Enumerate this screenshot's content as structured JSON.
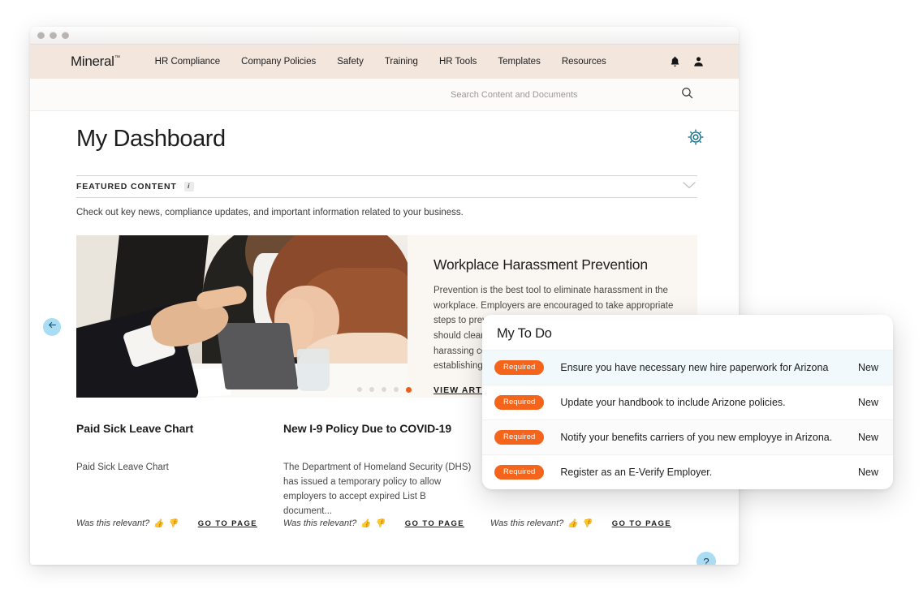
{
  "window": {
    "traffic_lights": [
      "close",
      "minimize",
      "maximize"
    ]
  },
  "nav": {
    "logo": "Mineral",
    "logo_tm": "™",
    "links": [
      {
        "label": "HR Compliance"
      },
      {
        "label": "Company Policies"
      },
      {
        "label": "Safety"
      },
      {
        "label": "Training"
      },
      {
        "label": "HR Tools"
      },
      {
        "label": "Templates"
      },
      {
        "label": "Resources"
      }
    ],
    "icons": [
      {
        "name": "bell-icon"
      },
      {
        "name": "user-avatar-icon"
      }
    ]
  },
  "search": {
    "placeholder": "Search Content and Documents",
    "value": "",
    "icon": "search-icon"
  },
  "dashboard": {
    "title": "My Dashboard",
    "settings_icon": "gear-icon",
    "settings_color": "#0f6d8c"
  },
  "featured": {
    "label": "FEATURED CONTENT",
    "info_icon": "info-icon",
    "info_glyph": "i",
    "collapse_icon": "chevron-down-icon",
    "subtitle": "Check out key news, compliance updates, and important information related to your business."
  },
  "hero": {
    "image_alt": "workplace-harassment-photo",
    "title": "Workplace Harassment Prevention",
    "body": "Prevention is the best tool to eliminate harassment in the workplace. Employers are encouraged to take appropriate steps to prevent and correct unlawful harassment. They should clearly communicate to employees that unwelcome harassing conduct will not be tolerated. They can do this by establishing an effec",
    "link": "VIEW ARTICLE"
  },
  "cards": [
    {
      "title": "Paid Sick Leave Chart",
      "body": "Paid Sick Leave Chart",
      "relevant_label": "Was this relevant?",
      "thumb_up": "👍",
      "thumb_down": "👎",
      "goto": "GO TO PAGE"
    },
    {
      "title": "New I-9 Policy Due to COVID-19",
      "body": "The Department of Homeland Security (DHS) has issued a temporary policy to allow employers to accept expired List B document...",
      "relevant_label": "Was this relevant?",
      "thumb_up": "👍",
      "thumb_down": "👎",
      "goto": "GO TO PAGE"
    },
    {
      "title": "",
      "body": "",
      "relevant_label": "Was this relevant?",
      "thumb_up": "👍",
      "thumb_down": "👎",
      "goto": "GO TO PAGE"
    }
  ],
  "carousel": {
    "prev_icon": "arrow-left-icon",
    "dot_count": 5,
    "active_dot_index": 4,
    "active_color": "#f25c19",
    "inactive_color": "#ded9d6"
  },
  "help": {
    "glyph": "?",
    "color": "#aadcf3"
  },
  "todo": {
    "title": "My To Do",
    "items": [
      {
        "badge": "Required",
        "text": "Ensure you have necessary new hire paperwork for Arizona",
        "state": "New"
      },
      {
        "badge": "Required",
        "text": "Update your handbook to include Arizone policies.",
        "state": "New"
      },
      {
        "badge": "Required",
        "text": "Notify your benefits carriers of you new employye in Arizona.",
        "state": "New"
      },
      {
        "badge": "Required",
        "text": "Register as an E-Verify Employer.",
        "state": "New"
      }
    ],
    "badge_color": "#f4641b"
  }
}
